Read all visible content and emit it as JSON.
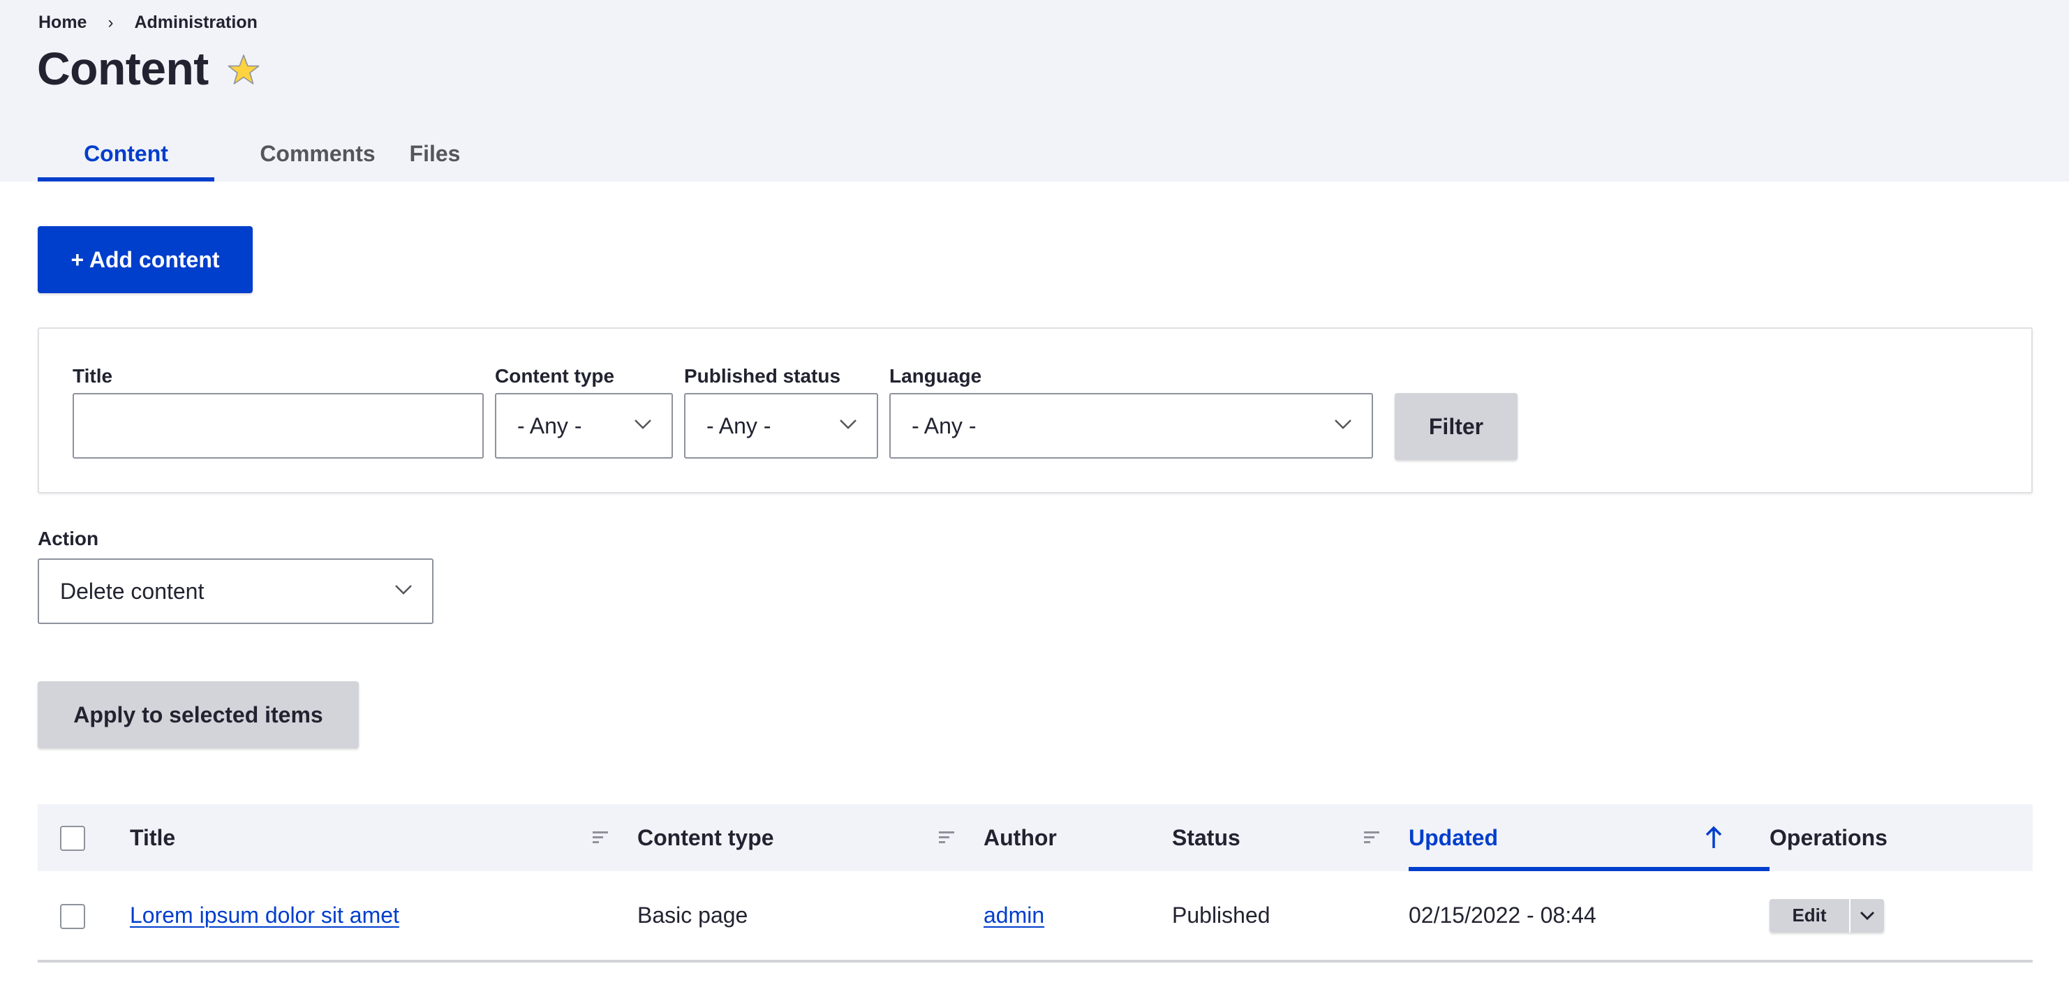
{
  "colors": {
    "accent": "#003ecc",
    "header_bg": "#f2f3f8",
    "text": "#222330",
    "secondary_button": "#d3d4d9",
    "star": "#ffd23f"
  },
  "breadcrumb": {
    "items": [
      "Home",
      "Administration"
    ],
    "separator": "›"
  },
  "header": {
    "title": "Content",
    "shortcut_icon": "star-icon"
  },
  "tabs": [
    {
      "label": "Content",
      "active": true
    },
    {
      "label": "Comments",
      "active": false
    },
    {
      "label": "Files",
      "active": false
    }
  ],
  "add_button": {
    "label": "+ Add content"
  },
  "filters": {
    "title": {
      "label": "Title",
      "value": "",
      "placeholder": ""
    },
    "content_type": {
      "label": "Content type",
      "value": "- Any -"
    },
    "published_status": {
      "label": "Published status",
      "value": "- Any -"
    },
    "language": {
      "label": "Language",
      "value": "- Any -"
    },
    "submit_label": "Filter"
  },
  "bulk": {
    "action_label": "Action",
    "action_value": "Delete content",
    "apply_label": "Apply to selected items"
  },
  "table": {
    "columns": [
      {
        "label": "Title",
        "sortable": true
      },
      {
        "label": "Content type",
        "sortable": true
      },
      {
        "label": "Author",
        "sortable": false
      },
      {
        "label": "Status",
        "sortable": true
      },
      {
        "label": "Updated",
        "sortable": true,
        "sorted": "ascending"
      },
      {
        "label": "Operations",
        "sortable": false
      }
    ],
    "rows": [
      {
        "title": "Lorem ipsum dolor sit amet",
        "content_type": "Basic page",
        "author": "admin",
        "status": "Published",
        "updated": "02/15/2022 - 08:44",
        "operation": "Edit"
      }
    ]
  }
}
